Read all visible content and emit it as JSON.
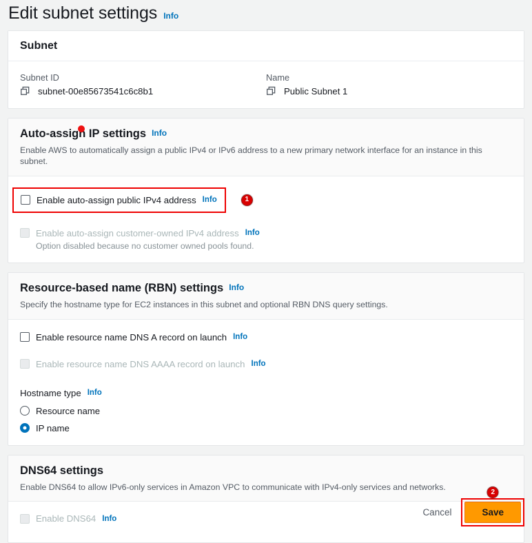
{
  "page": {
    "title": "Edit subnet settings",
    "info_label": "Info"
  },
  "subnet_card": {
    "title": "Subnet",
    "fields": [
      {
        "label": "Subnet ID",
        "value": "subnet-00e85673541c6c8b1",
        "icon": "copy-icon"
      },
      {
        "label": "Name",
        "value": "Public Subnet 1",
        "icon": "copy-icon"
      }
    ]
  },
  "auto_assign_card": {
    "title": "Auto-assign IP settings",
    "info_label": "Info",
    "description": "Enable AWS to automatically assign a public IPv4 or IPv6 address to a new primary network interface for an instance in this subnet.",
    "options": [
      {
        "label": "Enable auto-assign public IPv4 address",
        "info_label": "Info",
        "checked": false,
        "disabled": false,
        "highlighted": true,
        "badge": "1"
      },
      {
        "label": "Enable auto-assign customer-owned IPv4 address",
        "info_label": "Info",
        "checked": false,
        "disabled": true,
        "note": "Option disabled because no customer owned pools found."
      }
    ]
  },
  "rbn_card": {
    "title": "Resource-based name (RBN) settings",
    "info_label": "Info",
    "description": "Specify the hostname type for EC2 instances in this subnet and optional RBN DNS query settings.",
    "options": [
      {
        "label": "Enable resource name DNS A record on launch",
        "info_label": "Info",
        "checked": false,
        "disabled": false
      },
      {
        "label": "Enable resource name DNS AAAA record on launch",
        "info_label": "Info",
        "checked": false,
        "disabled": true
      }
    ],
    "hostname_type": {
      "label": "Hostname type",
      "info_label": "Info",
      "selected": "IP name",
      "choices": [
        {
          "label": "Resource name",
          "selected": false
        },
        {
          "label": "IP name",
          "selected": true
        }
      ]
    }
  },
  "dns64_card": {
    "title": "DNS64 settings",
    "description": "Enable DNS64 to allow IPv6-only services in Amazon VPC to communicate with IPv4-only services and networks.",
    "options": [
      {
        "label": "Enable DNS64",
        "info_label": "Info",
        "checked": false,
        "disabled": true
      }
    ]
  },
  "footer": {
    "cancel_label": "Cancel",
    "save_label": "Save",
    "save_badge": "2"
  },
  "colors": {
    "accent_link": "#0073bb",
    "save_button": "#ff9900",
    "annotation_red": "#ee0000",
    "badge_red": "#d90000",
    "page_background": "#f2f3f3"
  }
}
